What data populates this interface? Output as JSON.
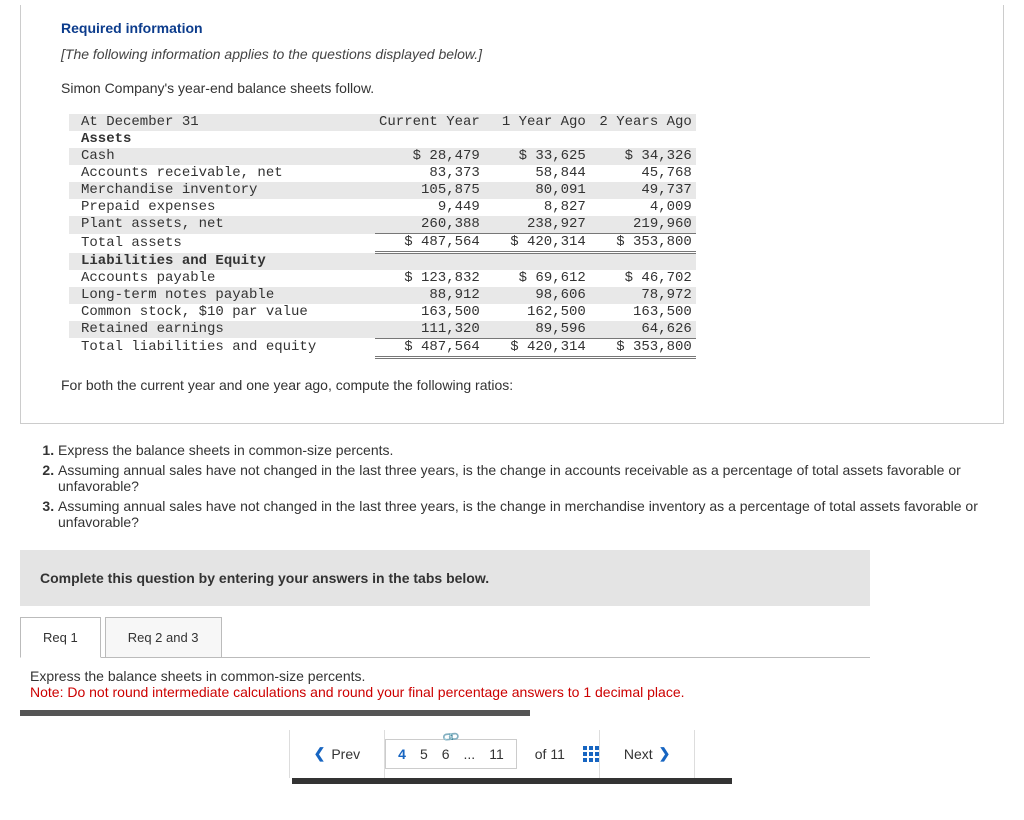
{
  "info": {
    "heading": "Required information",
    "note": "[The following information applies to the questions displayed below.]",
    "intro": "Simon Company's year-end balance sheets follow."
  },
  "table": {
    "header": {
      "label": "At December 31",
      "c1": "Current Year",
      "c2": "1 Year Ago",
      "c3": "2 Years Ago"
    },
    "assets_h": "Assets",
    "rows_a": [
      {
        "label": "Cash",
        "c1": "$ 28,479",
        "c2": "$ 33,625",
        "c3": "$ 34,326"
      },
      {
        "label": "Accounts receivable, net",
        "c1": "83,373",
        "c2": "58,844",
        "c3": "45,768"
      },
      {
        "label": "Merchandise inventory",
        "c1": "105,875",
        "c2": "80,091",
        "c3": "49,737"
      },
      {
        "label": "Prepaid expenses",
        "c1": "9,449",
        "c2": "8,827",
        "c3": "4,009"
      },
      {
        "label": "Plant assets, net",
        "c1": "260,388",
        "c2": "238,927",
        "c3": "219,960"
      }
    ],
    "total_a": {
      "label": "Total assets",
      "c1": "$ 487,564",
      "c2": "$ 420,314",
      "c3": "$ 353,800"
    },
    "liab_h": "Liabilities and Equity",
    "rows_l": [
      {
        "label": "Accounts payable",
        "c1": "$ 123,832",
        "c2": "$ 69,612",
        "c3": "$ 46,702"
      },
      {
        "label": "Long-term notes payable",
        "c1": "88,912",
        "c2": "98,606",
        "c3": "78,972"
      },
      {
        "label": "Common stock, $10 par value",
        "c1": "163,500",
        "c2": "162,500",
        "c3": "163,500"
      },
      {
        "label": "Retained earnings",
        "c1": "111,320",
        "c2": "89,596",
        "c3": "64,626"
      }
    ],
    "total_l": {
      "label": "Total liabilities and equity",
      "c1": "$ 487,564",
      "c2": "$ 420,314",
      "c3": "$ 353,800"
    }
  },
  "after_table": "For both the current year and one year ago, compute the following ratios:",
  "questions": [
    "Express the balance sheets in common-size percents.",
    "Assuming annual sales have not changed in the last three years, is the change in accounts receivable as a percentage of total assets favorable or unfavorable?",
    "Assuming annual sales have not changed in the last three years, is the change in merchandise inventory as a percentage of total assets favorable or unfavorable?"
  ],
  "instruction": "Complete this question by entering your answers in the tabs below.",
  "tabs": {
    "t1": "Req 1",
    "t2": "Req 2 and 3"
  },
  "panel": {
    "line1": "Express the balance sheets in common-size percents.",
    "line2": "Note: Do not round intermediate calculations and round your final percentage answers to 1 decimal place."
  },
  "nav": {
    "prev": "Prev",
    "next": "Next",
    "pages": [
      "4",
      "5",
      "6",
      "...",
      "11"
    ],
    "ofn": "of 11"
  }
}
